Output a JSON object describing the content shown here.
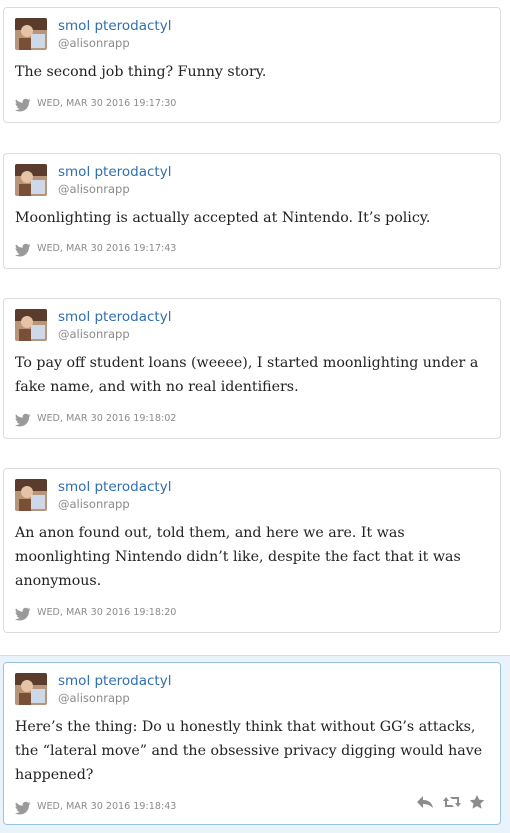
{
  "tweets": [
    {
      "name": "smol pterodactyl",
      "handle": "@alisonrapp",
      "text": "The second job thing? Funny story.",
      "timestamp": "WED, MAR 30 2016 19:17:30"
    },
    {
      "name": "smol pterodactyl",
      "handle": "@alisonrapp",
      "text": "Moonlighting is actually accepted at Nintendo. It’s policy.",
      "timestamp": "WED, MAR 30 2016 19:17:43"
    },
    {
      "name": "smol pterodactyl",
      "handle": "@alisonrapp",
      "text": "To pay off student loans (weeee), I started moonlighting under a fake name, and with no real identifiers.",
      "timestamp": "WED, MAR 30 2016 19:18:02"
    },
    {
      "name": "smol pterodactyl",
      "handle": "@alisonrapp",
      "text": "An anon found out, told them, and here we are. It was moonlighting Nintendo didn’t like, despite the fact that it was anonymous.",
      "timestamp": "WED, MAR 30 2016 19:18:20"
    },
    {
      "name": "smol pterodactyl",
      "handle": "@alisonrapp",
      "text": "Here’s the thing: Do u honestly think that without GG’s attacks, the “lateral move” and the obsessive privacy digging would have happened?",
      "timestamp": "WED, MAR 30 2016 19:18:43"
    }
  ],
  "actions": [
    "reply-icon",
    "retweet-icon",
    "favorite-icon"
  ],
  "colors": {
    "name": "#2f6fb0",
    "handle": "#8a8a8a",
    "timestamp": "#8c8c8c",
    "highlight_bg": "#e8f3fb"
  }
}
